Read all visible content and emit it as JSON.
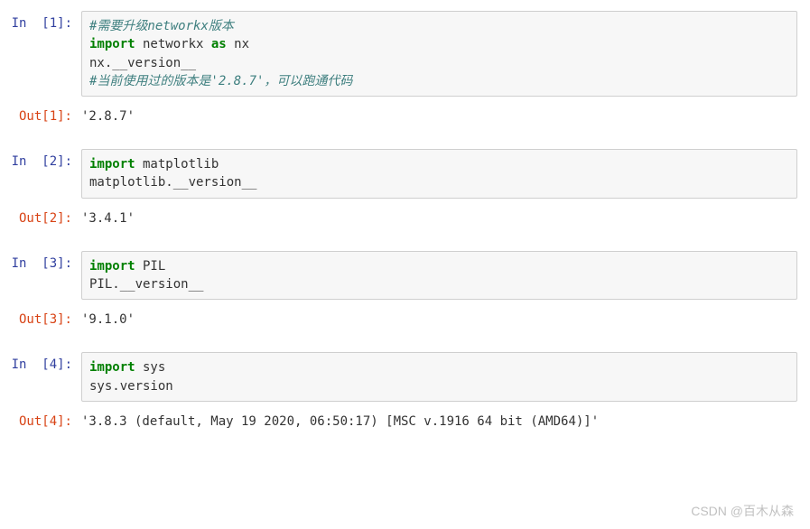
{
  "watermark": "CSDN @百木从森",
  "cells": [
    {
      "in_prompt": "In  [1]:",
      "out_prompt": "Out[1]:",
      "code": [
        {
          "frags": [
            {
              "cls": "tok-comment",
              "t": "#需要升级networkx版本"
            }
          ]
        },
        {
          "frags": [
            {
              "cls": "tok-keyword",
              "t": "import"
            },
            {
              "cls": "tok-plain",
              "t": " networkx "
            },
            {
              "cls": "tok-keyword",
              "t": "as"
            },
            {
              "cls": "tok-plain",
              "t": " nx"
            }
          ]
        },
        {
          "frags": [
            {
              "cls": "tok-plain",
              "t": "nx.__version__"
            }
          ]
        },
        {
          "frags": [
            {
              "cls": "tok-comment",
              "t": "#当前使用过的版本是'2.8.7'，可以跑通代码"
            }
          ]
        }
      ],
      "output": "'2.8.7'"
    },
    {
      "in_prompt": "In  [2]:",
      "out_prompt": "Out[2]:",
      "code": [
        {
          "frags": [
            {
              "cls": "tok-keyword",
              "t": "import"
            },
            {
              "cls": "tok-plain",
              "t": " matplotlib"
            }
          ]
        },
        {
          "frags": [
            {
              "cls": "tok-plain",
              "t": "matplotlib.__version__"
            }
          ]
        }
      ],
      "output": "'3.4.1'"
    },
    {
      "in_prompt": "In  [3]:",
      "out_prompt": "Out[3]:",
      "code": [
        {
          "frags": [
            {
              "cls": "tok-keyword",
              "t": "import"
            },
            {
              "cls": "tok-plain",
              "t": " PIL"
            }
          ]
        },
        {
          "frags": [
            {
              "cls": "tok-plain",
              "t": "PIL.__version__"
            }
          ]
        }
      ],
      "output": "'9.1.0'"
    },
    {
      "in_prompt": "In  [4]:",
      "out_prompt": "Out[4]:",
      "code": [
        {
          "frags": [
            {
              "cls": "tok-keyword",
              "t": "import"
            },
            {
              "cls": "tok-plain",
              "t": " sys"
            }
          ]
        },
        {
          "frags": [
            {
              "cls": "tok-plain",
              "t": "sys.version"
            }
          ]
        }
      ],
      "output": "'3.8.3 (default, May 19 2020, 06:50:17) [MSC v.1916 64 bit (AMD64)]'"
    }
  ]
}
